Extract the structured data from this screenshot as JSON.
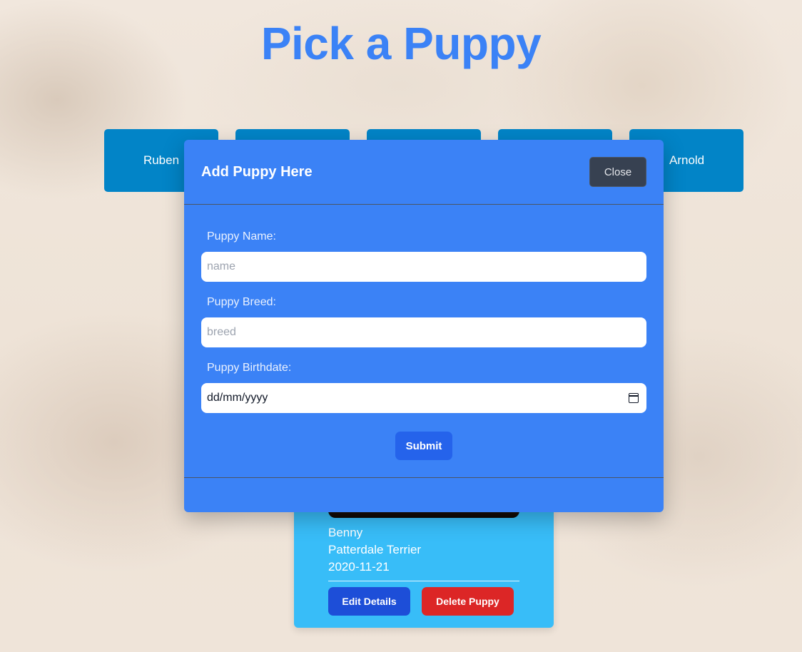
{
  "page": {
    "title": "Pick a Puppy"
  },
  "puppy_tabs": [
    {
      "name": "Ruben"
    },
    {
      "name": ""
    },
    {
      "name": ""
    },
    {
      "name": ""
    },
    {
      "name": "Arnold"
    }
  ],
  "card": {
    "name": "Benny",
    "breed": "Patterdale Terrier",
    "birthdate": "2020-11-21",
    "edit_label": "Edit Details",
    "delete_label": "Delete Puppy"
  },
  "modal": {
    "title": "Add Puppy Here",
    "close_label": "Close",
    "name_label": "Puppy Name:",
    "name_placeholder": "name",
    "breed_label": "Puppy Breed:",
    "breed_placeholder": "breed",
    "birthdate_label": "Puppy Birthdate:",
    "birthdate_value": "dd/mm/yyyy",
    "birthdate_icon": "calendar-icon",
    "submit_label": "Submit"
  },
  "colors": {
    "title": "#3b82f6",
    "tab": "#0284c7",
    "card": "#38bdf8",
    "modal": "#3b82f6",
    "close_button": "#374151",
    "submit_button": "#2563eb",
    "edit_button": "#1d4ed8",
    "delete_button": "#dc2626"
  }
}
